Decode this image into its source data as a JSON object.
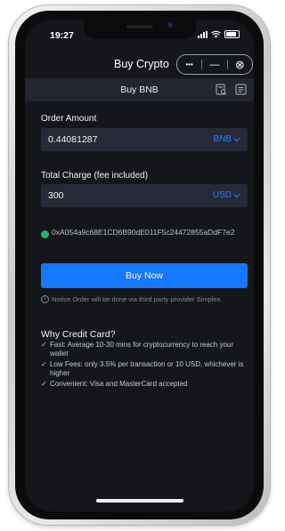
{
  "status_bar": {
    "time": "19:27"
  },
  "nav": {
    "title": "Buy Crypto",
    "more_label": "•••",
    "minimize_label": "—",
    "close_label": "⊗"
  },
  "subheader": {
    "title": "Buy BNB"
  },
  "order": {
    "label": "Order Amount",
    "value": "0.44081287",
    "unit": "BNB"
  },
  "charge": {
    "label": "Total Charge (fee included)",
    "value": "300",
    "unit": "USD"
  },
  "wallet": {
    "address": "0xA054a9c68E1CD6B90dE011F5c24472855aDdF7e2"
  },
  "buy_button": {
    "label": "Buy Now"
  },
  "notice": {
    "icon": "i",
    "text": "Notice Order will be done via third party provider Simplex."
  },
  "why": {
    "title": "Why Credit Card?",
    "items": [
      "Fast: Average 10-30 mins for cryptocurrency to reach your wallet",
      "Low Fees: only 3.5% per transaction or 10 USD, whichever is higher",
      "Convenient: Visa and MasterCard accepted"
    ]
  },
  "colors": {
    "accent": "#1677ff",
    "background": "#14161c",
    "field": "#262a36",
    "unit_text": "#2f7df6",
    "address_dot": "#26b36a"
  },
  "icons": [
    "wifi-icon",
    "signal-icon",
    "battery-icon",
    "more-icon",
    "minimize-icon",
    "close-icon",
    "search-document-icon",
    "list-icon",
    "chevron-down-icon",
    "info-icon",
    "check-icon"
  ]
}
